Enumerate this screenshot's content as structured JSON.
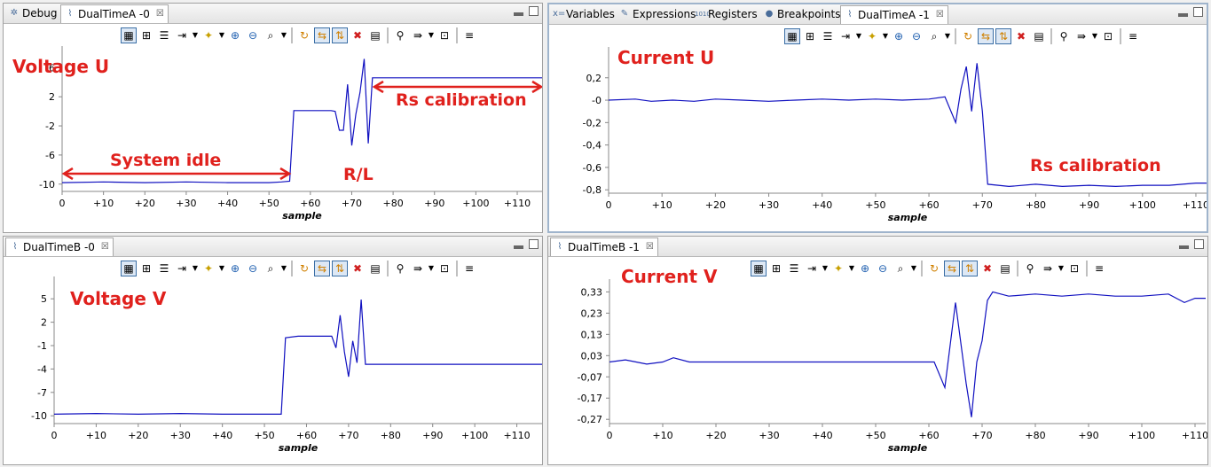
{
  "tabs": {
    "top_left": [
      {
        "label": "Debug",
        "icon": "debug-icon",
        "active": false
      },
      {
        "label": "DualTimeA -0",
        "icon": "chart-icon",
        "active": true,
        "close": "☒"
      }
    ],
    "top_right": [
      {
        "label": "Variables",
        "icon": "variables-icon",
        "active": false
      },
      {
        "label": "Expressions",
        "icon": "expressions-icon",
        "active": false
      },
      {
        "label": "Registers",
        "icon": "registers-icon",
        "active": false
      },
      {
        "label": "Breakpoints",
        "icon": "breakpoints-icon",
        "active": false
      },
      {
        "label": "DualTimeA -1",
        "icon": "chart-icon",
        "active": true,
        "close": "☒"
      }
    ],
    "bottom_left": [
      {
        "label": "DualTimeB -0",
        "icon": "chart-icon",
        "active": true,
        "close": "☒"
      }
    ],
    "bottom_right": [
      {
        "label": "DualTimeB -1",
        "icon": "chart-icon",
        "active": true,
        "close": "☒"
      }
    ]
  },
  "toolbar_icons": [
    "graph-icon",
    "align-icon",
    "stack-icon",
    "marker-icon",
    "star-icon",
    "zoom-in-icon",
    "zoom-out-icon",
    "zoom-fit-icon",
    "refresh-icon",
    "sync-h-icon",
    "sync-v-icon",
    "clear-icon",
    "list-icon",
    "binoculars-icon",
    "export-icon",
    "lock-icon",
    "settings-icon"
  ],
  "colors": {
    "trace": "#1010c0",
    "annotation": "#e0211d"
  },
  "chart_data": [
    {
      "type": "line",
      "title": "",
      "xlabel": "sample",
      "ylabel": "",
      "xlim": [
        0,
        116
      ],
      "ylim": [
        -11,
        7.5
      ],
      "x_ticks": [
        "0",
        "+10",
        "+20",
        "+30",
        "+40",
        "+50",
        "+60",
        "+70",
        "+80",
        "+90",
        "+100",
        "+110"
      ],
      "y_ticks": [
        "6",
        "2",
        "-2",
        "-6",
        "-10"
      ],
      "y_tick_values": [
        6,
        2,
        -2,
        -6,
        -10
      ],
      "annotations": [
        "Voltage U",
        "System idle",
        "R/L",
        "Rs calibration"
      ],
      "series": [
        {
          "values": [
            [
              0,
              -9.8
            ],
            [
              10,
              -9.7
            ],
            [
              20,
              -9.8
            ],
            [
              30,
              -9.7
            ],
            [
              40,
              -9.8
            ],
            [
              50,
              -9.8
            ],
            [
              53,
              -9.7
            ],
            [
              55,
              -9.6
            ],
            [
              56,
              0.1
            ],
            [
              58,
              0.1
            ],
            [
              60,
              0.1
            ],
            [
              65,
              0.1
            ],
            [
              66,
              0.0
            ],
            [
              67,
              -2.6
            ],
            [
              68,
              -2.6
            ],
            [
              69,
              3.7
            ],
            [
              70,
              -4.7
            ],
            [
              71,
              -0.4
            ],
            [
              72,
              2.6
            ],
            [
              73,
              7.2
            ],
            [
              74,
              -4.4
            ],
            [
              75,
              4.6
            ],
            [
              80,
              4.6
            ],
            [
              90,
              4.6
            ],
            [
              100,
              4.6
            ],
            [
              110,
              4.6
            ],
            [
              116,
              4.6
            ]
          ]
        }
      ]
    },
    {
      "type": "line",
      "title": "",
      "xlabel": "sample",
      "ylabel": "",
      "xlim": [
        0,
        112
      ],
      "ylim": [
        -0.83,
        0.38
      ],
      "x_ticks": [
        "0",
        "+10",
        "+20",
        "+30",
        "+40",
        "+50",
        "+60",
        "+70",
        "+80",
        "+90",
        "+100",
        "+110"
      ],
      "y_ticks": [
        "0,2",
        "-0",
        "-0,2",
        "-0,4",
        "-0,6",
        "-0,8"
      ],
      "y_tick_values": [
        0.2,
        0.0,
        -0.2,
        -0.4,
        -0.6,
        -0.8
      ],
      "annotations": [
        "Current U",
        "Rs calibration"
      ],
      "series": [
        {
          "values": [
            [
              0,
              0.0
            ],
            [
              5,
              0.01
            ],
            [
              8,
              -0.01
            ],
            [
              12,
              0.0
            ],
            [
              16,
              -0.01
            ],
            [
              20,
              0.01
            ],
            [
              25,
              0.0
            ],
            [
              30,
              -0.01
            ],
            [
              35,
              0.0
            ],
            [
              40,
              0.01
            ],
            [
              45,
              0.0
            ],
            [
              50,
              0.01
            ],
            [
              55,
              0.0
            ],
            [
              60,
              0.01
            ],
            [
              63,
              0.03
            ],
            [
              65,
              -0.2
            ],
            [
              66,
              0.1
            ],
            [
              67,
              0.3
            ],
            [
              68,
              -0.1
            ],
            [
              69,
              0.33
            ],
            [
              70,
              -0.1
            ],
            [
              71,
              -0.75
            ],
            [
              75,
              -0.77
            ],
            [
              80,
              -0.75
            ],
            [
              85,
              -0.77
            ],
            [
              90,
              -0.76
            ],
            [
              95,
              -0.77
            ],
            [
              100,
              -0.76
            ],
            [
              105,
              -0.76
            ],
            [
              110,
              -0.74
            ],
            [
              112,
              -0.74
            ]
          ]
        }
      ]
    },
    {
      "type": "line",
      "title": "",
      "xlabel": "sample",
      "ylabel": "",
      "xlim": [
        0,
        116
      ],
      "ylim": [
        -11,
        6.5
      ],
      "x_ticks": [
        "0",
        "+10",
        "+20",
        "+30",
        "+40",
        "+50",
        "+60",
        "+70",
        "+80",
        "+90",
        "+100",
        "+110"
      ],
      "y_ticks": [
        "5",
        "2",
        "-1",
        "-4",
        "-7",
        "-10"
      ],
      "y_tick_values": [
        5,
        2,
        -1,
        -4,
        -7,
        -10
      ],
      "annotations": [
        "Voltage V"
      ],
      "series": [
        {
          "values": [
            [
              0,
              -9.8
            ],
            [
              10,
              -9.7
            ],
            [
              20,
              -9.8
            ],
            [
              30,
              -9.7
            ],
            [
              40,
              -9.8
            ],
            [
              50,
              -9.8
            ],
            [
              54,
              -9.8
            ],
            [
              55,
              0.0
            ],
            [
              58,
              0.2
            ],
            [
              62,
              0.2
            ],
            [
              66,
              0.2
            ],
            [
              67,
              -1.3
            ],
            [
              68,
              2.9
            ],
            [
              69,
              -1.8
            ],
            [
              70,
              -5.0
            ],
            [
              71,
              -0.4
            ],
            [
              72,
              -3.2
            ],
            [
              73,
              4.9
            ],
            [
              74,
              -3.4
            ],
            [
              80,
              -3.4
            ],
            [
              90,
              -3.4
            ],
            [
              100,
              -3.4
            ],
            [
              110,
              -3.4
            ],
            [
              116,
              -3.4
            ]
          ]
        }
      ]
    },
    {
      "type": "line",
      "title": "",
      "xlabel": "sample",
      "ylabel": "",
      "xlim": [
        0,
        112
      ],
      "ylim": [
        -0.29,
        0.34
      ],
      "x_ticks": [
        "0",
        "+10",
        "+20",
        "+30",
        "+40",
        "+50",
        "+60",
        "+70",
        "+80",
        "+90",
        "+100",
        "+110"
      ],
      "y_ticks": [
        "0,33",
        "0,23",
        "0,13",
        "0,03",
        "-0,07",
        "-0,17",
        "-0,27"
      ],
      "y_tick_values": [
        0.33,
        0.23,
        0.13,
        0.03,
        -0.07,
        -0.17,
        -0.27
      ],
      "annotations": [
        "Current V"
      ],
      "series": [
        {
          "values": [
            [
              0,
              0.0
            ],
            [
              3,
              0.01
            ],
            [
              5,
              0.0
            ],
            [
              7,
              -0.01
            ],
            [
              10,
              0.0
            ],
            [
              12,
              0.02
            ],
            [
              15,
              0.0
            ],
            [
              20,
              0.0
            ],
            [
              25,
              0.0
            ],
            [
              30,
              0.0
            ],
            [
              35,
              0.0
            ],
            [
              40,
              0.0
            ],
            [
              45,
              0.0
            ],
            [
              50,
              0.0
            ],
            [
              55,
              0.0
            ],
            [
              58,
              0.0
            ],
            [
              61,
              0.0
            ],
            [
              63,
              -0.12
            ],
            [
              65,
              0.28
            ],
            [
              67,
              -0.1
            ],
            [
              68,
              -0.26
            ],
            [
              69,
              0.0
            ],
            [
              70,
              0.1
            ],
            [
              71,
              0.29
            ],
            [
              72,
              0.33
            ],
            [
              75,
              0.31
            ],
            [
              80,
              0.32
            ],
            [
              85,
              0.31
            ],
            [
              90,
              0.32
            ],
            [
              95,
              0.31
            ],
            [
              100,
              0.31
            ],
            [
              105,
              0.32
            ],
            [
              108,
              0.28
            ],
            [
              110,
              0.3
            ],
            [
              112,
              0.3
            ]
          ]
        }
      ]
    }
  ]
}
